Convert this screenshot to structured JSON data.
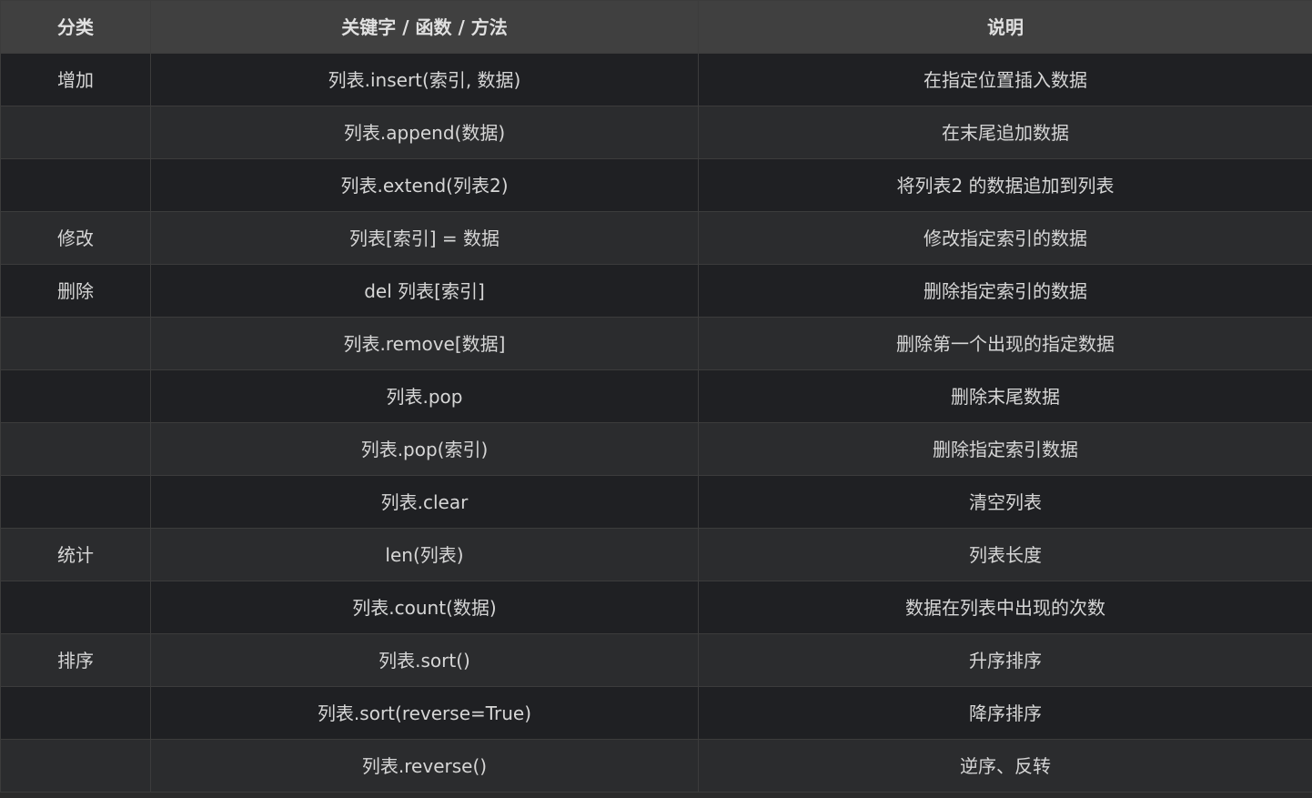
{
  "table": {
    "headers": [
      "分类",
      "关键字 / 函数 / 方法",
      "说明"
    ],
    "rows": [
      {
        "category": "增加",
        "method": "列表.insert(索引, 数据)",
        "description": "在指定位置插入数据"
      },
      {
        "category": "",
        "method": "列表.append(数据)",
        "description": "在末尾追加数据"
      },
      {
        "category": "",
        "method": "列表.extend(列表2)",
        "description": "将列表2 的数据追加到列表"
      },
      {
        "category": "修改",
        "method": "列表[索引] = 数据",
        "description": "修改指定索引的数据"
      },
      {
        "category": "删除",
        "method": "del 列表[索引]",
        "description": "删除指定索引的数据"
      },
      {
        "category": "",
        "method": "列表.remove[数据]",
        "description": "删除第一个出现的指定数据"
      },
      {
        "category": "",
        "method": "列表.pop",
        "description": "删除末尾数据"
      },
      {
        "category": "",
        "method": "列表.pop(索引)",
        "description": "删除指定索引数据"
      },
      {
        "category": "",
        "method": "列表.clear",
        "description": "清空列表"
      },
      {
        "category": "统计",
        "method": "len(列表)",
        "description": "列表长度"
      },
      {
        "category": "",
        "method": "列表.count(数据)",
        "description": "数据在列表中出现的次数"
      },
      {
        "category": "排序",
        "method": "列表.sort()",
        "description": "升序排序"
      },
      {
        "category": "",
        "method": "列表.sort(reverse=True)",
        "description": "降序排序"
      },
      {
        "category": "",
        "method": "列表.reverse()",
        "description": "逆序、反转"
      }
    ]
  }
}
